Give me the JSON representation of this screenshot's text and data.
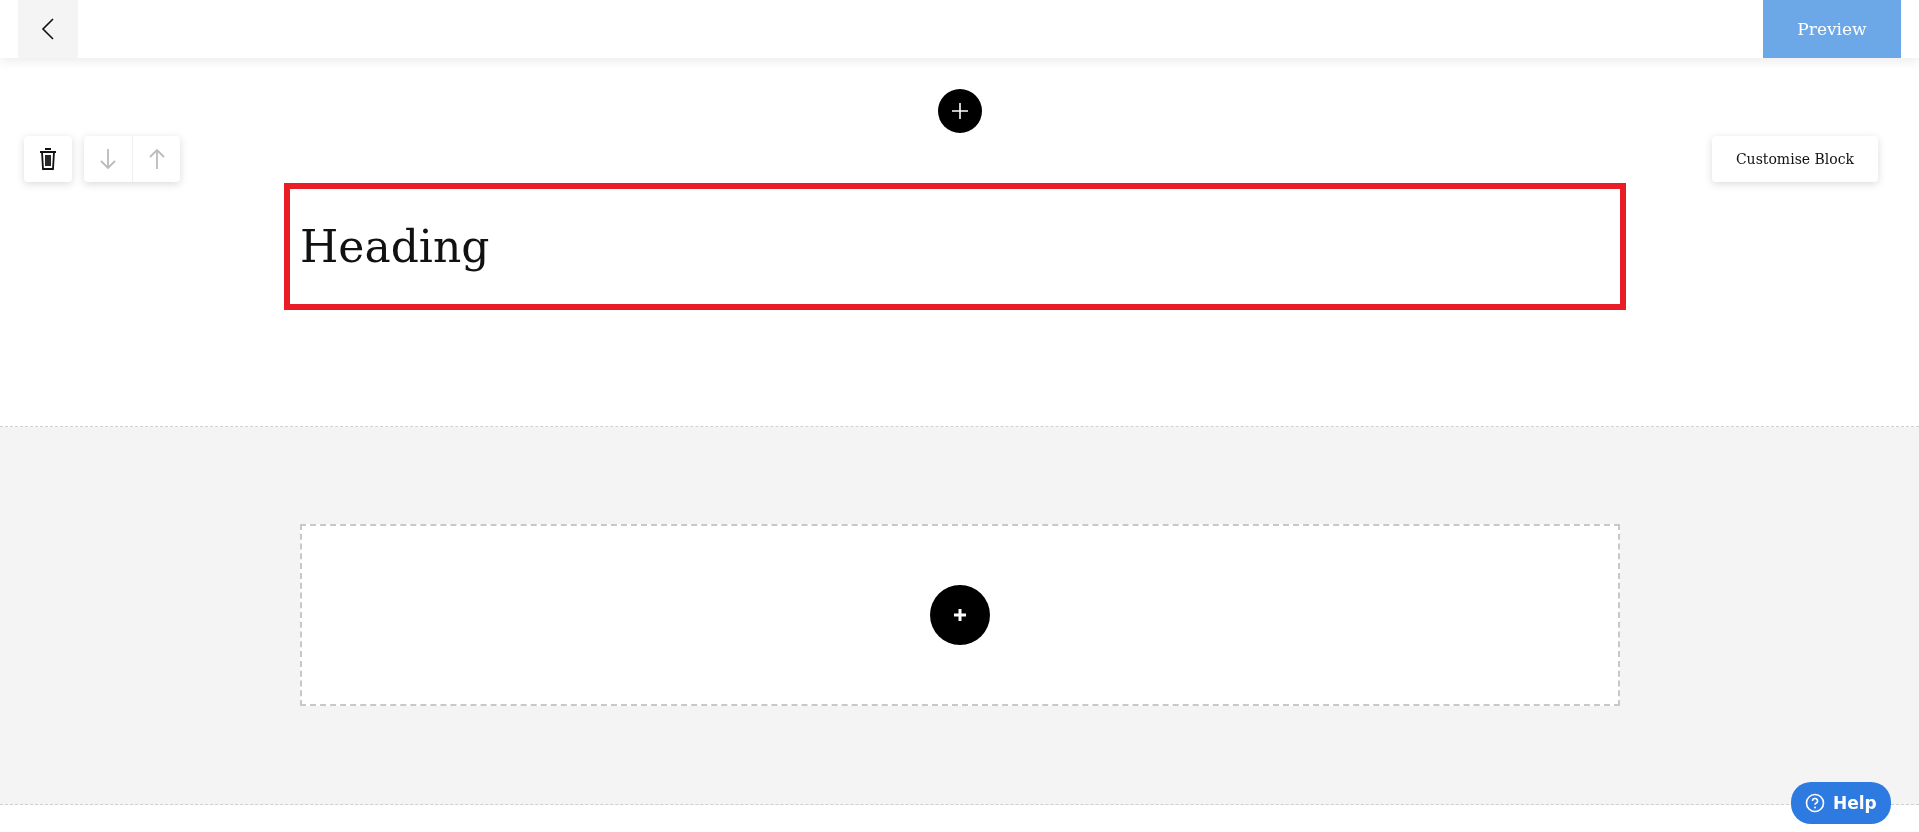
{
  "top_bar": {
    "preview_button": "Preview"
  },
  "block_toolbar": {
    "move_buttons": [
      {
        "kind": "down",
        "disabled": true
      },
      {
        "kind": "up",
        "disabled": true
      }
    ],
    "customise_button": "Customise Block"
  },
  "heading_block": {
    "text": "Heading",
    "selected": true
  },
  "help_button": "Help"
}
